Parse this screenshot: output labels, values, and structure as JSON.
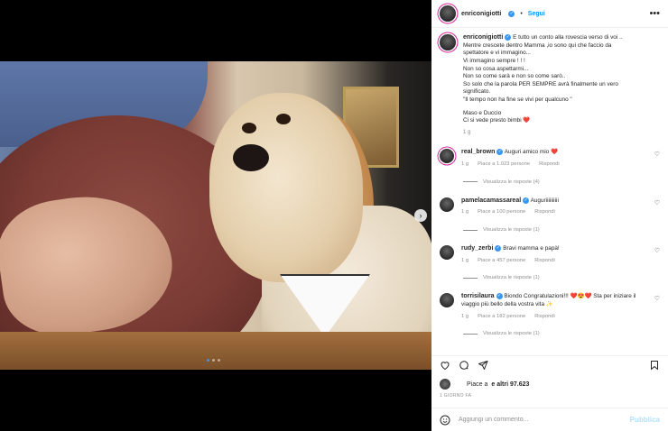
{
  "post": {
    "author": "enriconigiotti",
    "follow_label": "Segui",
    "more_label": "•••",
    "carousel": {
      "total": 3,
      "active_index": 0
    }
  },
  "caption": {
    "author": "enriconigiotti",
    "lines": [
      "E tutto un conto alla rovescia verso di voi ..",
      "Mentre crescete dentro Mamma ,io sono qui che faccio da",
      "spettatore e vi immagino...",
      "Vi immagino sempre ! ! !",
      "Non so cosa aspettarmi...",
      "Non so come sarà e non so come sarò..",
      "So solo che la parola PER SEMPRE avrà finalmente un vero",
      "significato.",
      "\"Il tempo non ha fine se vivi per qualcuno \"",
      "",
      "Maso e Duccio",
      "Ci si vede presto bimbi ❤️"
    ],
    "time": "1 g"
  },
  "comments": [
    {
      "user": "real_brown",
      "verified": true,
      "text": "Auguri amico mio ❤️",
      "time": "1 g",
      "likes": "Piace a 1.023 persone",
      "reply": "Rispondi",
      "replies": "Visualizza le risposte (4)"
    },
    {
      "user": "pamelacamassareal",
      "verified": true,
      "text": "Auguriiiiiiiiii",
      "time": "1 g",
      "likes": "Piace a 100 persone",
      "reply": "Rispondi",
      "replies": "Visualizza le risposte (1)"
    },
    {
      "user": "rudy_zerbi",
      "verified": true,
      "text": "Bravi mamma e papà!",
      "time": "1 g",
      "likes": "Piace a 457 persone",
      "reply": "Rispondi",
      "replies": "Visualizza le risposte (1)"
    },
    {
      "user": "torrisilaura",
      "verified": true,
      "text": "Biondo Congratulazioni!!! ❤️😍❤️ Sta per iniziare il viaggio più bello della vostra vita ✨",
      "time": "1 g",
      "likes": "Piace a 182 persone",
      "reply": "Rispondi",
      "replies": "Visualizza le risposte (1)"
    }
  ],
  "likes_summary": {
    "prefix": "Piace a",
    "and_others": "e altri 97.623"
  },
  "date": "1 GIORNO FA",
  "add_comment": {
    "placeholder": "Aggiungi un commento...",
    "publish_label": "Pubblica"
  },
  "colors": {
    "verified": "#3897f0",
    "follow": "#0095f6",
    "heart": "#ed4956",
    "publish_disabled": "#b2dffc"
  }
}
